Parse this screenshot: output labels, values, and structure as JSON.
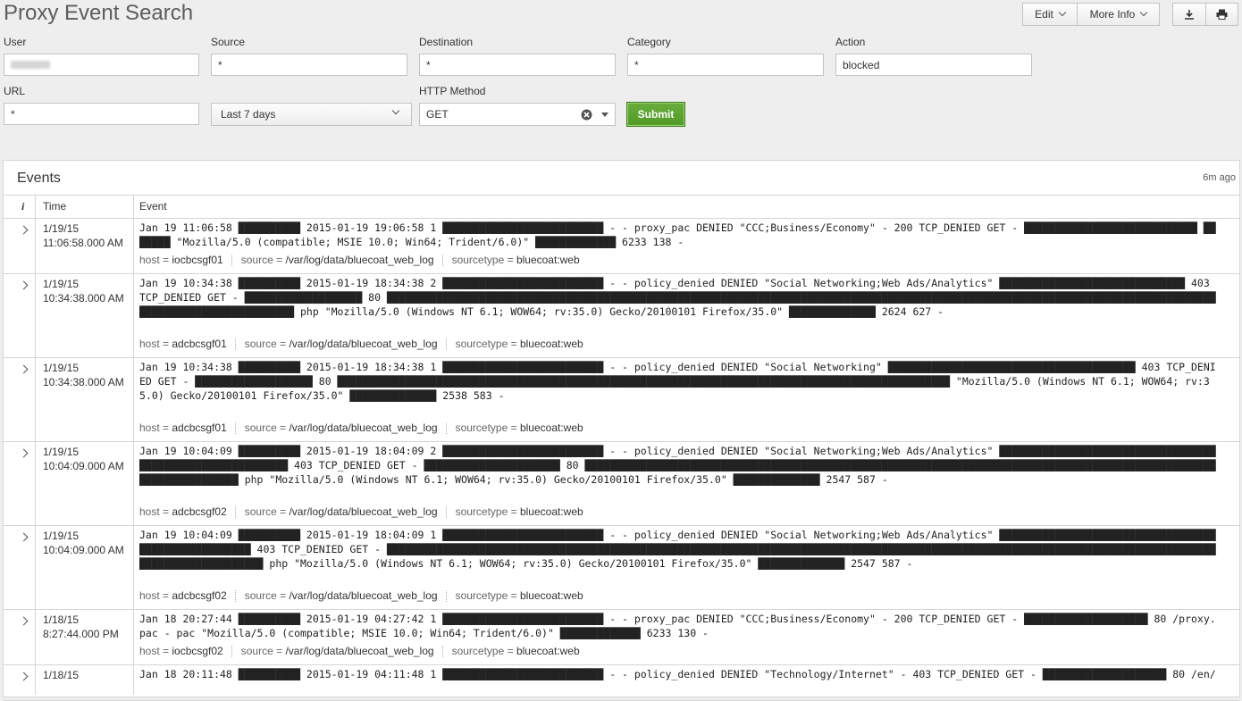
{
  "header": {
    "title": "Proxy Event Search",
    "edit_label": "Edit",
    "more_info_label": "More Info",
    "download_icon": "download-icon",
    "print_icon": "print-icon"
  },
  "form": {
    "user_label": "User",
    "source_label": "Source",
    "source_value": "*",
    "destination_label": "Destination",
    "destination_value": "*",
    "category_label": "Category",
    "category_value": "*",
    "action_label": "Action",
    "action_value": "blocked",
    "url_label": "URL",
    "url_value": "*",
    "timerange_value": "Last 7 days",
    "http_method_label": "HTTP Method",
    "http_method_value": "GET",
    "submit_label": "Submit"
  },
  "events_panel": {
    "title": "Events",
    "updated": "6m ago",
    "col_info": "i",
    "col_time": "Time",
    "col_event": "Event",
    "rows": [
      {
        "date": "1/19/15",
        "time": "11:06:58.000 AM",
        "raw": "Jan 19 11:06:58 ██████████ 2015-01-19 19:06:58 1 ██████████████████████████ - - proxy_pac DENIED \"CCC;Business/Economy\" - 200 TCP_DENIED GET - ████████████████████████████ ███████ \"Mozilla/5.0 (compatible; MSIE 10.0; Win64; Trident/6.0)\" █████████████ 6233 138 -",
        "host_k": "host = ",
        "host": "iocbcsgf01",
        "source_k": "source = ",
        "source": "/var/log/data/bluecoat_web_log",
        "stype_k": "sourcetype = ",
        "stype": "bluecoat:web"
      },
      {
        "date": "1/19/15",
        "time": "10:34:38.000 AM",
        "raw": "Jan 19 10:34:38 ██████████ 2015-01-19 18:34:38 2 ██████████████████████████ - - policy_denied DENIED \"Social Networking;Web Ads/Analytics\" ██████████████████████████████ 403 TCP_DENIED GET - ███████████████████ 80 ███████████████████████████████████████████████████████████████████████████████████████████████████████████████████████████████████████████████████████████████ php \"Mozilla/5.0 (Windows NT 6.1; WOW64; rv:35.0) Gecko/20100101 Firefox/35.0\" ██████████████ 2624 627 -",
        "host_k": "host = ",
        "host": "adcbcsgf01",
        "source_k": "source = ",
        "source": "/var/log/data/bluecoat_web_log",
        "stype_k": "sourcetype = ",
        "stype": "bluecoat:web"
      },
      {
        "date": "1/19/15",
        "time": "10:34:38.000 AM",
        "raw": "Jan 19 10:34:38 ██████████ 2015-01-19 18:34:38 1 ██████████████████████████ - - policy_denied DENIED \"Social Networking\" ████████████████████████████████████████ 403 TCP_DENIED GET - ███████████████████ 80 ███████████████████████████████████████████████████████████████████████████████████████████████████ \"Mozilla/5.0 (Windows NT 6.1; WOW64; rv:35.0) Gecko/20100101 Firefox/35.0\" ██████████████ 2538 583 -",
        "host_k": "host = ",
        "host": "adcbcsgf01",
        "source_k": "source = ",
        "source": "/var/log/data/bluecoat_web_log",
        "stype_k": "sourcetype = ",
        "stype": "bluecoat:web"
      },
      {
        "date": "1/19/15",
        "time": "10:04:09.000 AM",
        "raw": "Jan 19 10:04:09 ██████████ 2015-01-19 18:04:09 2 ██████████████████████████ - - policy_denied DENIED \"Social Networking;Web Ads/Analytics\" ███████████████████████████████████████████████████████████ 403 TCP_DENIED GET - ██████████████████████ 80 ██████████████████████████████████████████████████████████████████████████████████████████████████████████████████████ php \"Mozilla/5.0 (Windows NT 6.1; WOW64; rv:35.0) Gecko/20100101 Firefox/35.0\" ██████████████ 2547 587 -",
        "host_k": "host = ",
        "host": "adcbcsgf02",
        "source_k": "source = ",
        "source": "/var/log/data/bluecoat_web_log",
        "stype_k": "sourcetype = ",
        "stype": "bluecoat:web"
      },
      {
        "date": "1/19/15",
        "time": "10:04:09.000 AM",
        "raw": "Jan 19 10:04:09 ██████████ 2015-01-19 18:04:09 1 ██████████████████████████ - - policy_denied DENIED \"Social Networking;Web Ads/Analytics\" █████████████████████████████████████████████████████ 403 TCP_DENIED GET - ██████████████████████████████████████████████████████████████████████████████████████████████████████████████████████████████████████████████████████████ php \"Mozilla/5.0 (Windows NT 6.1; WOW64; rv:35.0) Gecko/20100101 Firefox/35.0\" ██████████████ 2547 587 -",
        "host_k": "host = ",
        "host": "adcbcsgf02",
        "source_k": "source = ",
        "source": "/var/log/data/bluecoat_web_log",
        "stype_k": "sourcetype = ",
        "stype": "bluecoat:web"
      },
      {
        "date": "1/18/15",
        "time": "8:27:44.000 PM",
        "raw": "Jan 18 20:27:44 ██████████ 2015-01-19 04:27:42 1 ██████████████████████████ - - proxy_pac DENIED \"CCC;Business/Economy\" - 200 TCP_DENIED GET - ████████████████████ 80 /proxy.pac - pac \"Mozilla/5.0 (compatible; MSIE 10.0; Win64; Trident/6.0)\" █████████████ 6233 130 -",
        "host_k": "host = ",
        "host": "iocbcsgf02",
        "source_k": "source = ",
        "source": "/var/log/data/bluecoat_web_log",
        "stype_k": "sourcetype = ",
        "stype": "bluecoat:web"
      },
      {
        "date": "1/18/15",
        "time": "",
        "raw": "Jan 18 20:11:48 ██████████ 2015-01-19 04:11:48 1 ██████████████████████████ - - policy_denied DENIED \"Technology/Internet\" - 403 TCP_DENIED GET - ████████████████████ 80 /en/",
        "host_k": "",
        "host": "",
        "source_k": "",
        "source": "",
        "stype_k": "",
        "stype": ""
      }
    ]
  }
}
